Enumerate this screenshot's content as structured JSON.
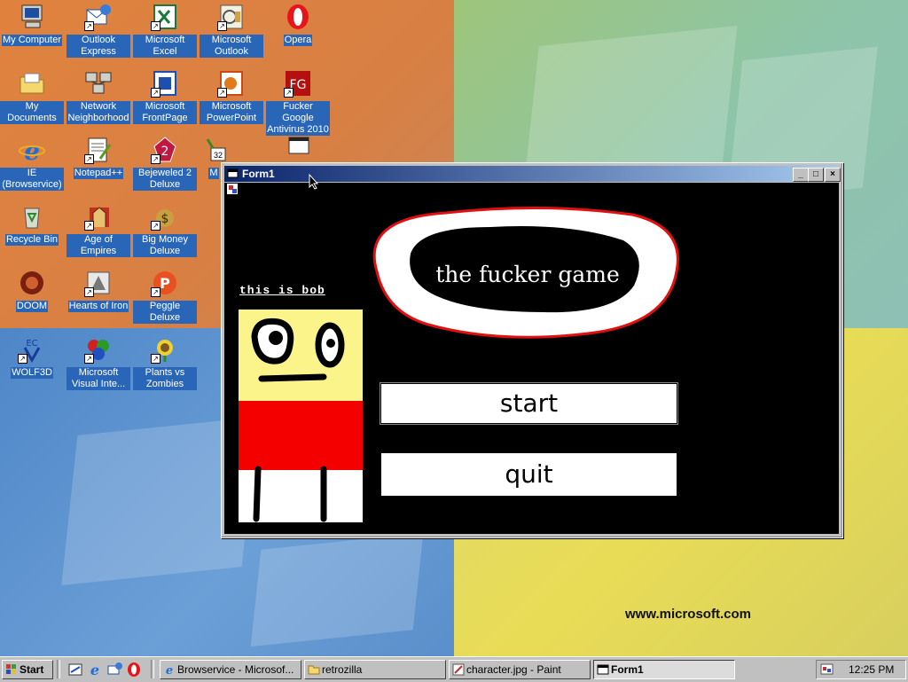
{
  "desktop": {
    "icons": [
      {
        "label": "My Computer",
        "icon": "computer-icon"
      },
      {
        "label": "Outlook Express",
        "icon": "outlook-express-icon"
      },
      {
        "label": "Microsoft Excel",
        "icon": "excel-icon"
      },
      {
        "label": "Microsoft Outlook",
        "icon": "outlook-icon"
      },
      {
        "label": "Opera",
        "icon": "opera-icon"
      },
      {
        "label": "My Documents",
        "icon": "folder-icon"
      },
      {
        "label": "Network Neighborhood",
        "icon": "network-icon"
      },
      {
        "label": "Microsoft FrontPage",
        "icon": "frontpage-icon"
      },
      {
        "label": "Microsoft PowerPoint",
        "icon": "powerpoint-icon"
      },
      {
        "label": "Fucker Google Antivirus 2010",
        "icon": "fg-antivirus-icon"
      },
      {
        "label": "IE (Browservice)",
        "icon": "ie-icon"
      },
      {
        "label": "Notepad++",
        "icon": "notepad-icon"
      },
      {
        "label": "Bejeweled 2 Deluxe",
        "icon": "bejeweled-icon"
      },
      {
        "label": "Recycle Bin",
        "icon": "recycle-bin-icon"
      },
      {
        "label": "Age of Empires",
        "icon": "age-of-empires-icon"
      },
      {
        "label": "Big Money Deluxe",
        "icon": "big-money-icon"
      },
      {
        "label": "DOOM",
        "icon": "doom-icon"
      },
      {
        "label": "Hearts of Iron",
        "icon": "hearts-of-iron-icon"
      },
      {
        "label": "Peggle Deluxe",
        "icon": "peggle-icon"
      },
      {
        "label": "WOLF3D",
        "icon": "wolf3d-icon"
      },
      {
        "label": "Microsoft Visual Inte...",
        "icon": "visual-interdev-icon"
      },
      {
        "label": "Plants vs Zombies",
        "icon": "plants-vs-zombies-icon"
      }
    ],
    "partial_labels": [
      "M",
      "Visu",
      "M",
      "Vis",
      "M",
      "Visu",
      "M"
    ],
    "watermark": "www.microsoft.com"
  },
  "window": {
    "title": "Form1",
    "controls": {
      "minimize": "_",
      "maximize": "□",
      "close": "×"
    },
    "bob_label": "this is bob",
    "game_title": "the fucker game",
    "start_label": "start",
    "quit_label": "quit"
  },
  "taskbar": {
    "start_label": "Start",
    "tasks": [
      {
        "label": "Browservice - Microsof...",
        "icon": "ie-icon"
      },
      {
        "label": "retrozilla",
        "icon": "folder-icon"
      },
      {
        "label": "character.jpg - Paint",
        "icon": "paint-icon"
      },
      {
        "label": "Form1",
        "icon": "window-icon"
      }
    ],
    "clock": "12:25 PM"
  },
  "colors": {
    "titlebar_start": "#0a246a",
    "titlebar_end": "#a6caf0",
    "bubble_outline": "#e01010",
    "bob_yellow": "#fbf48a",
    "bob_red": "#f50000"
  }
}
